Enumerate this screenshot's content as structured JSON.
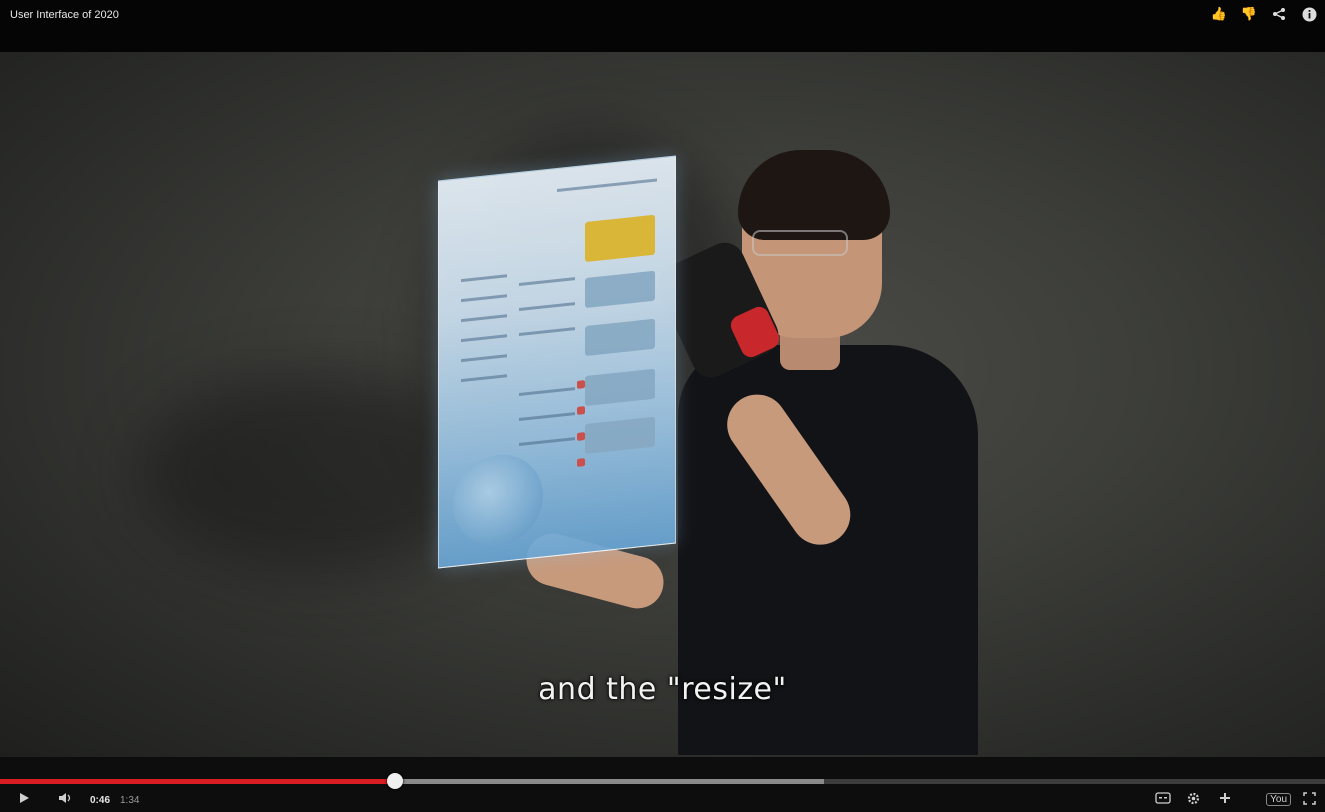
{
  "video": {
    "title": "User Interface of 2020",
    "caption": "and the \"resize\""
  },
  "top_actions": {
    "like_icon": "thumbs-up-icon",
    "dislike_icon": "thumbs-down-icon",
    "share_icon": "share-icon",
    "info_icon": "info-icon"
  },
  "player": {
    "current_time": "0:46",
    "total_time": "1:34",
    "progress_played": 0.298,
    "progress_buffered": 0.622,
    "colors": {
      "played": "#d81e23",
      "buffered": "#8a8a8a",
      "track": "#3c3c3c"
    },
    "icons": {
      "play": "play-icon",
      "volume": "volume-icon",
      "captions": "captions-icon",
      "settings": "settings-icon",
      "watch_later": "watch-later-icon",
      "youtube": "youtube-logo",
      "fullscreen": "fullscreen-icon"
    },
    "youtube_label": "You"
  }
}
